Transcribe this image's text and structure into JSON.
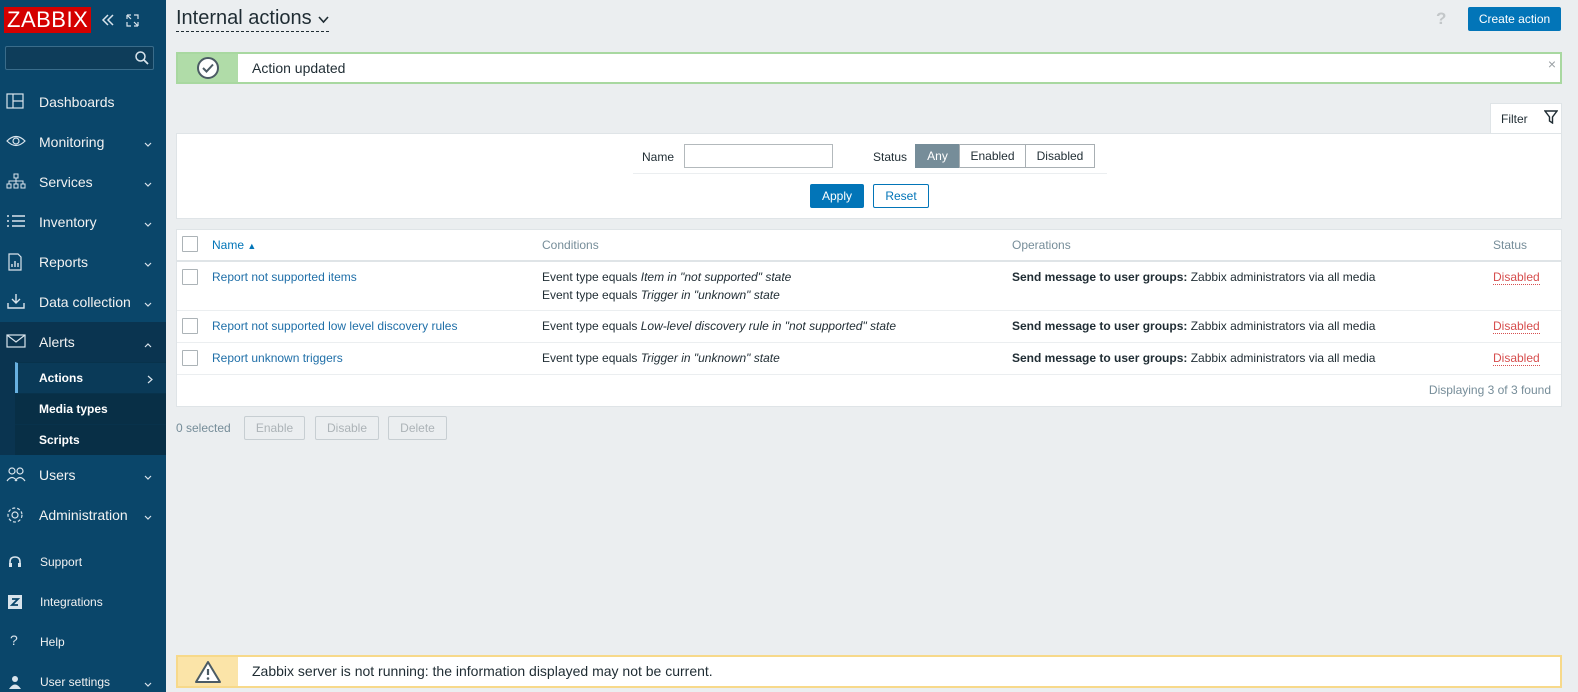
{
  "sidebar": {
    "logo": "ZABBIX",
    "nav": [
      {
        "label": "Dashboards",
        "icon": "dashboards-icon",
        "has_chevron": false
      },
      {
        "label": "Monitoring",
        "icon": "eye-icon",
        "has_chevron": true
      },
      {
        "label": "Services",
        "icon": "services-icon",
        "has_chevron": true
      },
      {
        "label": "Inventory",
        "icon": "list-icon",
        "has_chevron": true
      },
      {
        "label": "Reports",
        "icon": "report-icon",
        "has_chevron": true
      },
      {
        "label": "Data collection",
        "icon": "download-icon",
        "has_chevron": true
      },
      {
        "label": "Alerts",
        "icon": "envelope-icon",
        "has_chevron": true,
        "open": true
      },
      {
        "label": "Users",
        "icon": "users-icon",
        "has_chevron": true
      },
      {
        "label": "Administration",
        "icon": "gear-icon",
        "has_chevron": true
      }
    ],
    "alerts_sub": [
      {
        "label": "Actions",
        "active": true
      },
      {
        "label": "Media types"
      },
      {
        "label": "Scripts"
      }
    ],
    "bottom": [
      {
        "label": "Support",
        "icon": "headset-icon"
      },
      {
        "label": "Integrations",
        "icon": "integrations-icon"
      },
      {
        "label": "Help",
        "icon": "question-icon"
      },
      {
        "label": "User settings",
        "icon": "user-icon"
      }
    ]
  },
  "header": {
    "title": "Internal actions",
    "help": "?",
    "create_button": "Create action"
  },
  "message": {
    "text": "Action updated",
    "close": "×"
  },
  "filter": {
    "tab_label": "Filter",
    "name_label": "Name",
    "name_value": "",
    "status_label": "Status",
    "status_options": [
      "Any",
      "Enabled",
      "Disabled"
    ],
    "status_selected": "Any",
    "apply": "Apply",
    "reset": "Reset"
  },
  "table": {
    "columns": {
      "name": "Name",
      "sort_arrow": "▲",
      "conditions": "Conditions",
      "operations": "Operations",
      "status": "Status"
    },
    "rows": [
      {
        "name": "Report not supported items",
        "conditions": [
          {
            "prefix": "Event type equals ",
            "value": "Item in \"not supported\" state"
          },
          {
            "prefix": "Event type equals ",
            "value": "Trigger in \"unknown\" state"
          }
        ],
        "op_label": "Send message to user groups:",
        "op_value": " Zabbix administrators via all media",
        "status": "Disabled"
      },
      {
        "name": "Report not supported low level discovery rules",
        "conditions": [
          {
            "prefix": "Event type equals ",
            "value": "Low-level discovery rule in \"not supported\" state"
          }
        ],
        "op_label": "Send message to user groups:",
        "op_value": " Zabbix administrators via all media",
        "status": "Disabled"
      },
      {
        "name": "Report unknown triggers",
        "conditions": [
          {
            "prefix": "Event type equals ",
            "value": "Trigger in \"unknown\" state"
          }
        ],
        "op_label": "Send message to user groups:",
        "op_value": " Zabbix administrators via all media",
        "status": "Disabled"
      }
    ],
    "footer": "Displaying 3 of 3 found"
  },
  "mass": {
    "selected": "0 selected",
    "enable": "Enable",
    "disable": "Disable",
    "delete": "Delete"
  },
  "warning": {
    "text": "Zabbix server is not running: the information displayed may not be current."
  },
  "colors": {
    "sidebar": "#0a466a",
    "primary": "#0275b8",
    "logo_red": "#d40000",
    "success_border": "#a8d8a0",
    "warning_border": "#f7d98a",
    "disabled_red": "#d64e4e"
  }
}
